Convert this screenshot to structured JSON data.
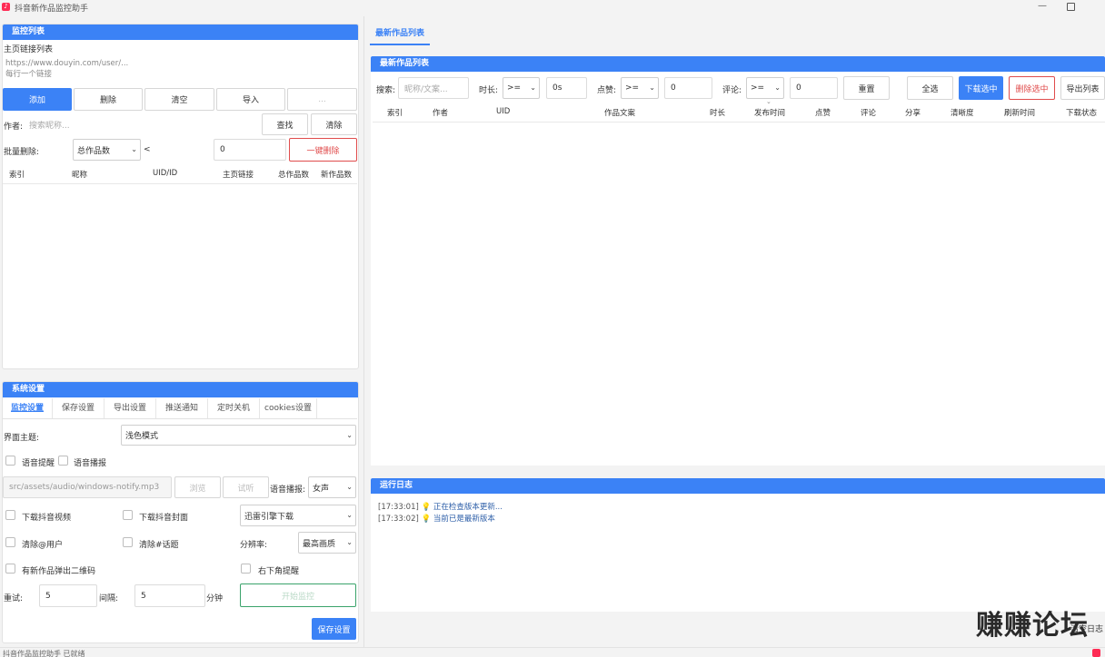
{
  "window": {
    "title": "抖音新作品监控助手",
    "icon": "douyin-logo-icon"
  },
  "monitor": {
    "header": "监控列表",
    "urls_label": "主页链接列表",
    "urls_placeholder": "https://www.douyin.com/user/...\n每行一个链接",
    "buttons": {
      "add": "添加",
      "delete": "删除",
      "clear": "清空",
      "import": "导入",
      "extra": "..."
    },
    "author_label": "作者:",
    "author_placeholder": "搜索昵称...",
    "find_button": "查找",
    "clear_button": "清除",
    "bulk_label": "批量删除:",
    "bulk_field": "总作品数",
    "bulk_op": "<",
    "bulk_value": "0",
    "bulk_button": "一键删除",
    "columns": [
      "索引",
      "昵称",
      "UID/ID",
      "主页链接",
      "总作品数",
      "新作品数"
    ]
  },
  "settings": {
    "header": "系统设置",
    "tabs": [
      "监控设置",
      "保存设置",
      "导出设置",
      "推送通知",
      "定时关机",
      "cookies设置"
    ],
    "active_tab": 0,
    "theme_label": "界面主题:",
    "theme_value": "浅色模式",
    "voice_alert": "语音提醒",
    "voice_broadcast": "语音播报",
    "sound_path": "src/assets/audio/windows-notify.mp3",
    "sound_btn1": "浏览",
    "sound_btn2": "试听",
    "voice_label": "语音播报:",
    "voice_value": "女声",
    "download_video": "下载抖音视频",
    "download_cover": "下载抖音封面",
    "downloader_value": "迅雷引擎下载",
    "clean_at": "清除@用户",
    "clean_topic": "清除#话题",
    "resolution_label": "分辨率:",
    "resolution_value": "最高画质",
    "qr_popup": "有新作品弹出二维码",
    "corner_alert": "右下角提醒",
    "retry_label": "重试:",
    "retry_value": "5",
    "interval_label": "间隔:",
    "interval_value": "5",
    "interval_unit": "分钟",
    "start_button": "开始监控",
    "save_button": "保存设置"
  },
  "works": {
    "tab": "最新作品列表",
    "header": "最新作品列表",
    "search_label": "搜索:",
    "search_placeholder": "昵称/文案...",
    "duration_label": "时长:",
    "duration_op": ">=",
    "duration_value": "0s",
    "likes_label": "点赞:",
    "likes_op": ">=",
    "likes_value": "0",
    "comments_label": "评论:",
    "comments_op": ">=",
    "comments_value": "0",
    "reset_button": "重置",
    "select_all_button": "全选",
    "download_selected_button": "下载选中",
    "delete_selected_button": "删除选中",
    "export_button": "导出列表",
    "columns": [
      "索引",
      "作者",
      "UID",
      "作品文案",
      "时长",
      "发布时间",
      "点赞",
      "评论",
      "分享",
      "清晰度",
      "刷新时间",
      "下载状态"
    ]
  },
  "log": {
    "header": "运行日志",
    "entries": [
      {
        "time": "[17:33:01]",
        "message": "正在检查版本更新..."
      },
      {
        "time": "[17:33:02]",
        "message": "当前已是最新版本"
      }
    ],
    "clear_button": "清空日志"
  },
  "statusbar": {
    "text": "抖音作品监控助手 已就绪"
  },
  "watermark": "赚赚论坛",
  "colors": {
    "accent": "#3b82f6",
    "danger": "#e04c4c",
    "success": "#3aa36b"
  }
}
